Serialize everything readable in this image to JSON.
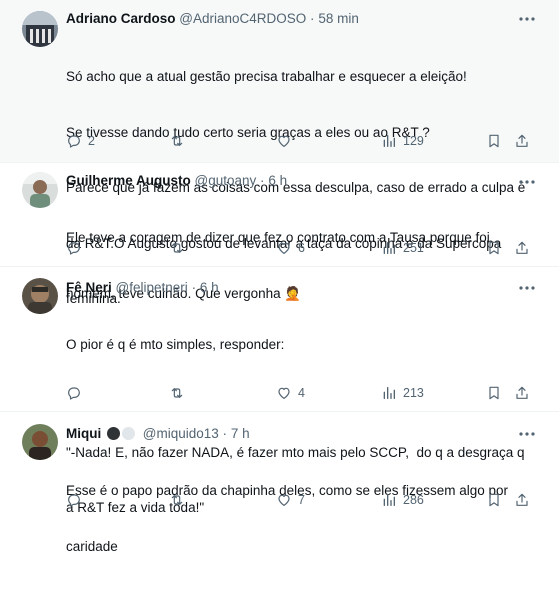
{
  "tweets": [
    {
      "name": "Adriano Cardoso",
      "handle": "@AdrianoC4RDOSO",
      "sep": "·",
      "time": "58 min",
      "lines": [
        "Só acho que a atual gestão precisa trabalhar e esquecer a eleição!",
        "Se tivesse dando tudo certo seria graças a eles ou ao R&T ?",
        "Parece que já fazem as coisas com essa desculpa, caso de errado a culpa é",
        "da R&T.O Augusto gostou de levantar a taça da copinha e da Supercopa",
        "feminina."
      ],
      "replies": "2",
      "retweets": "",
      "likes": "",
      "views": "129"
    },
    {
      "name": "Guilherme Augusto",
      "handle": "@gutoany",
      "sep": "·",
      "time": "6 h",
      "lines": [
        "Ele teve a coragem de dizer que fez o contrato com a Tausa porque foi",
        "homem, teve culhão. Que vergonha 🤦"
      ],
      "replies": "",
      "retweets": "",
      "likes": "6",
      "views": "251"
    },
    {
      "name": "Fê Neri",
      "handle": "@felipetneri",
      "sep": "·",
      "time": "6 h",
      "lines": [
        "O pior é q é mto simples, responder:",
        "",
        "\"-Nada! E, não fazer NADA, é fazer mto mais pelo SCCP,  do q a desgraça q",
        "a R&T fez a vida toda!\""
      ],
      "replies": "",
      "retweets": "",
      "likes": "4",
      "views": "213"
    },
    {
      "name": "Miqui",
      "handle": "@miquido13",
      "sep": "·",
      "time": "7 h",
      "lines": [
        "Esse é o papo padrão da chapinha deles, como se eles fizessem algo por",
        "caridade"
      ],
      "replies": "",
      "retweets": "",
      "likes": "7",
      "views": "286"
    }
  ],
  "icons": {
    "reply": "reply-icon",
    "retweet": "retweet-icon",
    "like": "like-icon",
    "views": "views-icon",
    "bookmark": "bookmark-icon",
    "share": "share-icon",
    "more": "more-icon"
  },
  "colors": {
    "text": "#0f1419",
    "muted": "#536471",
    "highlight_bg": "#f7f9f9",
    "divider": "#eff3f4"
  }
}
